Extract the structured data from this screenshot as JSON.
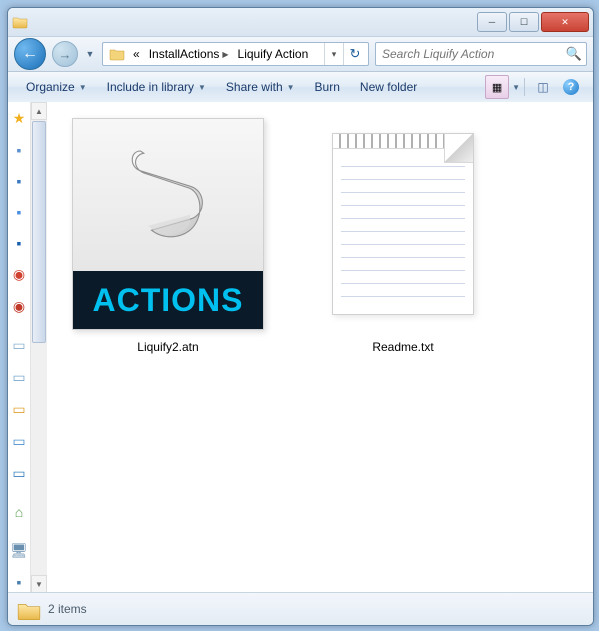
{
  "title": "",
  "breadcrumb": {
    "prefix": "«",
    "seg1": "InstallActions",
    "seg2": "Liquify Action"
  },
  "search": {
    "placeholder": "Search Liquify Action"
  },
  "toolbar": {
    "organize": "Organize",
    "include": "Include in library",
    "share": "Share with",
    "burn": "Burn",
    "newfolder": "New folder"
  },
  "files": [
    {
      "name": "Liquify2.atn",
      "band": "ACTIONS",
      "kind": "atn"
    },
    {
      "name": "Readme.txt",
      "kind": "txt"
    }
  ],
  "status": {
    "count": "2 items"
  }
}
